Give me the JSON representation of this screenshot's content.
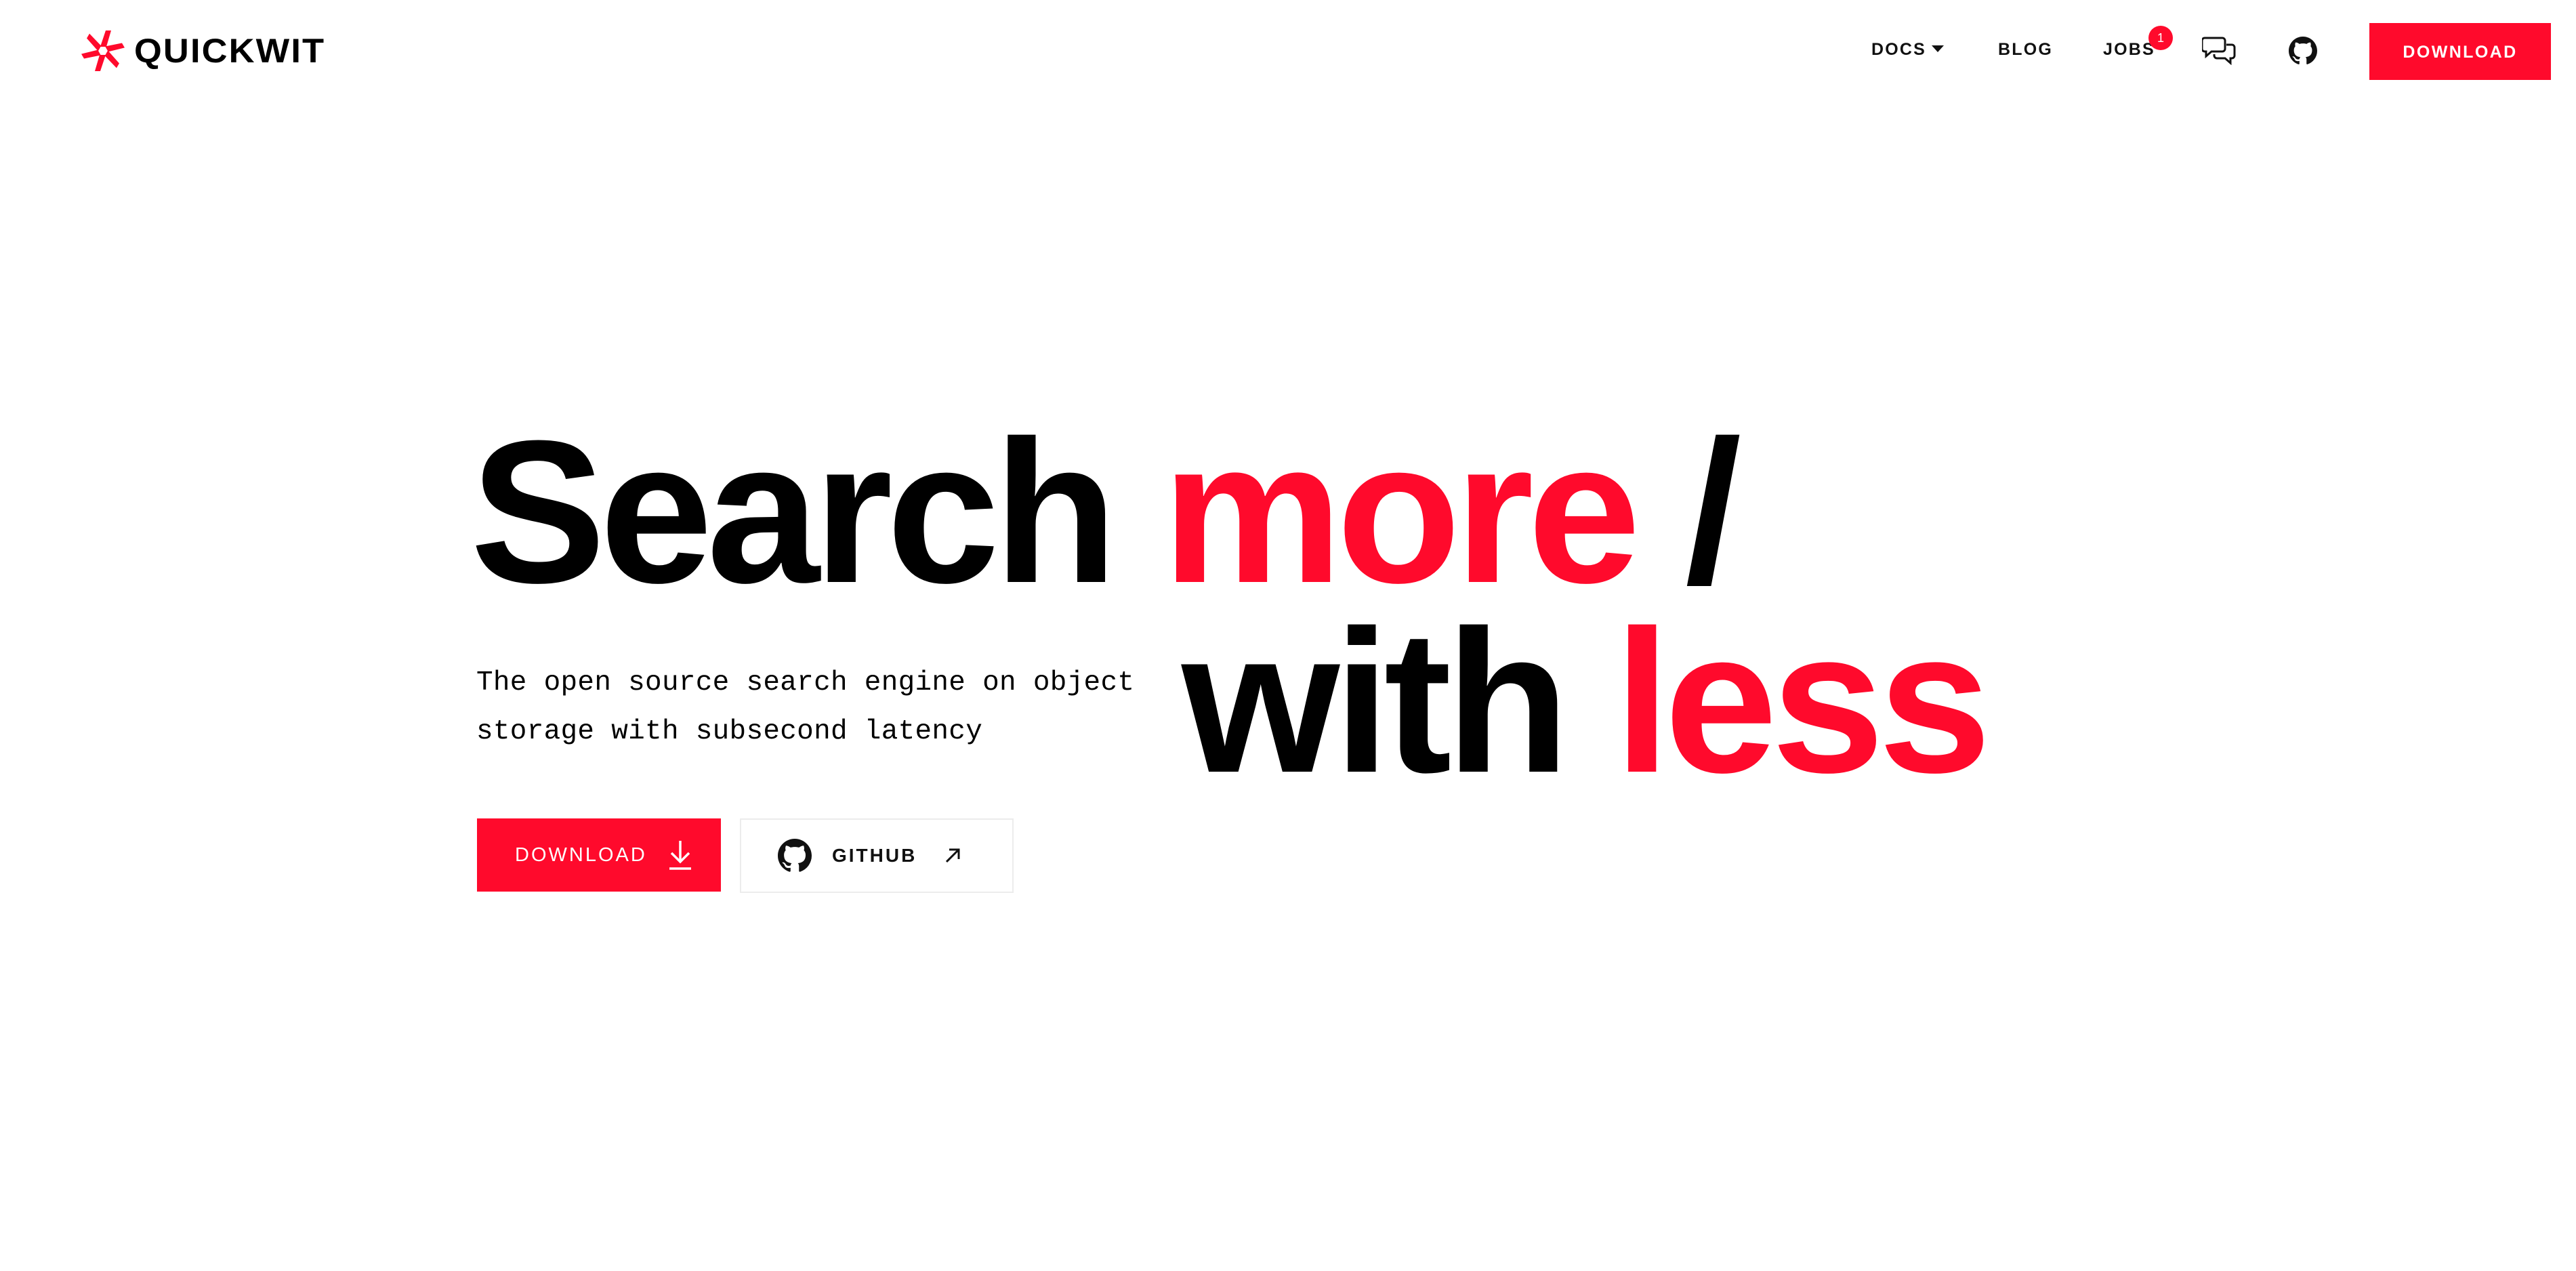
{
  "brand": {
    "name": "QUICKWIT",
    "accent_color": "#ff0a2c",
    "logo_icon": "quickwit-logo-icon"
  },
  "nav": {
    "items": [
      {
        "label": "DOCS",
        "has_dropdown": true
      },
      {
        "label": "BLOG"
      },
      {
        "label": "JOBS",
        "badge": "1"
      }
    ],
    "icons": [
      "chat-icon",
      "github-icon"
    ],
    "cta_label": "DOWNLOAD"
  },
  "hero": {
    "title_line1_part1": "Search ",
    "title_line1_part2": "more",
    "title_line1_part3": " /",
    "title_line2_part1": "with ",
    "title_line2_part2": "less",
    "subtitle_line1": "The open source search engine on object",
    "subtitle_line2": "storage with subsecond latency",
    "primary_button_label": "DOWNLOAD",
    "primary_button_icon": "download-arrow-icon",
    "secondary_button_label": "GITHUB",
    "secondary_button_icons": [
      "github-icon",
      "external-link-arrow-icon"
    ]
  }
}
